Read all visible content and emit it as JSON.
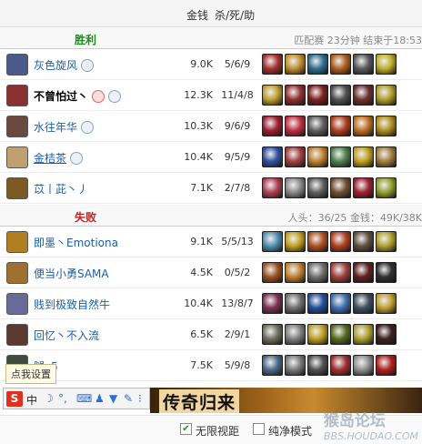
{
  "header": {
    "col_gold": "金钱",
    "col_kda": "杀/死/助"
  },
  "win": {
    "label": "胜利",
    "color": "#1a8a1a",
    "info": "匹配赛  23分钟  结束于18:53"
  },
  "lose": {
    "label": "失败",
    "color": "#cc1a1a",
    "info": "人头：36/25  金钱：49K/38K"
  },
  "win_players": [
    {
      "name": "灰色旋风",
      "gold": "9.0K",
      "kda": "5/6/9"
    },
    {
      "name": "不曾怕过丶",
      "gold": "12.3K",
      "kda": "11/4/8"
    },
    {
      "name": "水往年华",
      "gold": "10.3K",
      "kda": "9/6/9"
    },
    {
      "name": "金桔茶",
      "gold": "10.4K",
      "kda": "9/5/9"
    },
    {
      "name": "苡丨茈丶丿",
      "gold": "7.1K",
      "kda": "2/7/8"
    }
  ],
  "lose_players": [
    {
      "name": "即墨丶Emotiona",
      "gold": "9.1K",
      "kda": "5/5/13"
    },
    {
      "name": "便当小勇SAMA",
      "gold": "4.5K",
      "kda": "0/5/2"
    },
    {
      "name": "贱到极致自然牛",
      "gold": "10.4K",
      "kda": "13/8/7"
    },
    {
      "name": "回忆丶不入流",
      "gold": "6.5K",
      "kda": "2/9/1"
    },
    {
      "name": "腿v5",
      "gold": "7.5K",
      "kda": "5/9/8"
    }
  ],
  "tooltip": "点我设置",
  "ime": {
    "logo": "S",
    "lang": "中"
  },
  "banner": {
    "text": "传奇归来"
  },
  "footer": {
    "opt1": "无限视距",
    "opt1_checked": true,
    "opt2": "纯净模式",
    "opt2_checked": false
  },
  "watermark": {
    "big": "猴岛论坛",
    "small": "BBS.HOUDAO.COM"
  }
}
